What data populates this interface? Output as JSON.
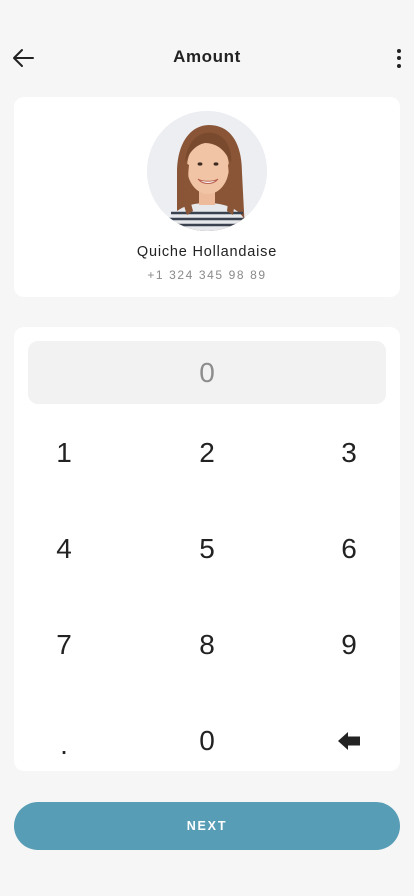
{
  "header": {
    "title": "Amount",
    "back_icon": "arrow-left-icon",
    "more_icon": "more-vertical-icon"
  },
  "contact": {
    "name": "Quiche Hollandaise",
    "phone": "+1 324 345 98 89"
  },
  "amount": {
    "value": "0"
  },
  "keypad": {
    "k1": "1",
    "k2": "2",
    "k3": "3",
    "k4": "4",
    "k5": "5",
    "k6": "6",
    "k7": "7",
    "k8": "8",
    "k9": "9",
    "dot": ".",
    "k0": "0",
    "backspace_icon": "backspace-icon"
  },
  "next_button": {
    "label": "NEXT"
  },
  "colors": {
    "background": "#f6f6f6",
    "card": "#ffffff",
    "display": "#f2f2f2",
    "accent": "#579db6",
    "text": "#222222",
    "muted": "#8a8a8a"
  }
}
